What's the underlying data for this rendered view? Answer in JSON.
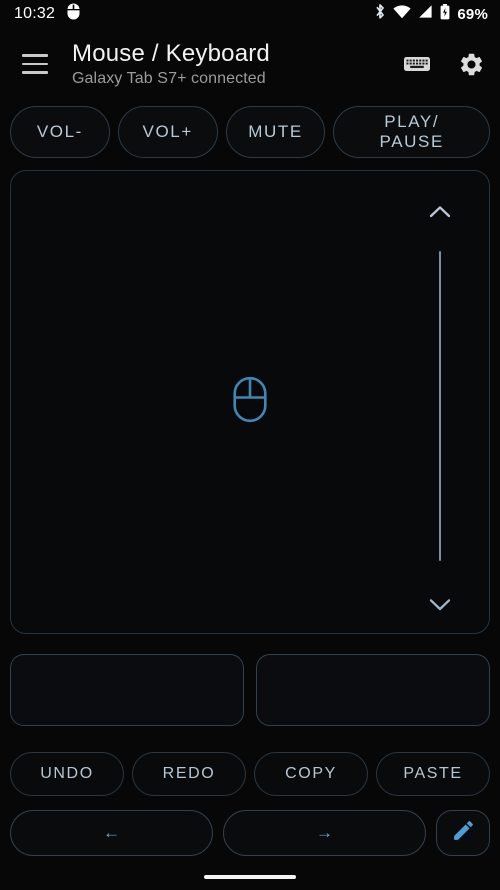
{
  "status_bar": {
    "time": "10:32",
    "battery_percent": "69%",
    "icons": [
      "mouse-icon",
      "bluetooth-icon",
      "wifi-icon",
      "cell-signal-icon",
      "battery-icon"
    ]
  },
  "header": {
    "menu_icon": "hamburger-menu-icon",
    "title": "Mouse / Keyboard",
    "subtitle": "Galaxy Tab S7+ connected",
    "keyboard_icon": "keyboard-icon",
    "settings_icon": "gear-icon"
  },
  "media_buttons": [
    {
      "label": "VOL-",
      "name": "volume-down-button"
    },
    {
      "label": "VOL+",
      "name": "volume-up-button"
    },
    {
      "label": "MUTE",
      "name": "mute-button"
    },
    {
      "label": "PLAY/\nPAUSE",
      "name": "play-pause-button"
    }
  ],
  "touchpad": {
    "center_icon": "mouse-icon",
    "scroll_up_icon": "chevron-up-icon",
    "scroll_down_icon": "chevron-down-icon"
  },
  "mouse_buttons": [
    {
      "label": "",
      "name": "left-click-button"
    },
    {
      "label": "",
      "name": "right-click-button"
    }
  ],
  "edit_buttons": [
    {
      "label": "UNDO",
      "name": "undo-button"
    },
    {
      "label": "REDO",
      "name": "redo-button"
    },
    {
      "label": "COPY",
      "name": "copy-button"
    },
    {
      "label": "PASTE",
      "name": "paste-button"
    }
  ],
  "nav_buttons": [
    {
      "label": "←",
      "name": "back-button"
    },
    {
      "label": "→",
      "name": "forward-button"
    }
  ],
  "edit_text_button": {
    "icon": "pencil-icon",
    "name": "edit-text-button"
  },
  "colors": {
    "background": "#070707",
    "accent_blue": "#4b9fd5",
    "outline": "#2d3b47",
    "label_text": "#b9c9d6",
    "title_text": "#f2f2f2",
    "subtitle_text": "#9b9b9b"
  }
}
